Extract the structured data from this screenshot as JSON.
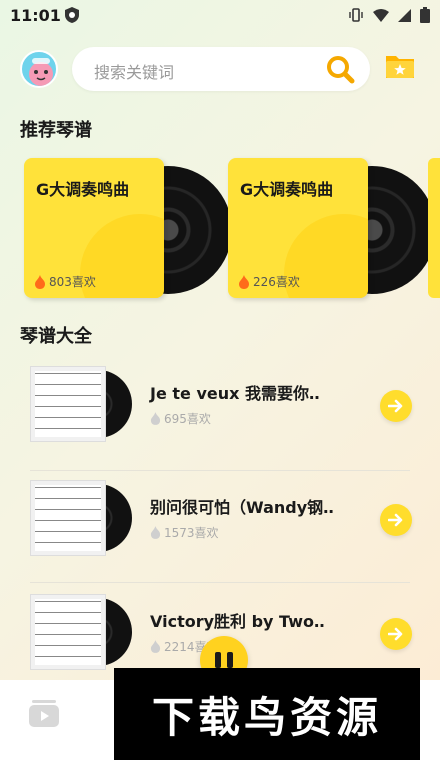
{
  "status_bar": {
    "time": "11:01"
  },
  "search": {
    "placeholder": "搜索关键词"
  },
  "recommended": {
    "title": "推荐琴谱",
    "cards": [
      {
        "title": "G大调奏鸣曲",
        "likes": "803喜欢"
      },
      {
        "title": "G大调奏鸣曲",
        "likes": "226喜欢"
      }
    ]
  },
  "library": {
    "title": "琴谱大全",
    "items": [
      {
        "title": "Je te veux 我需要你‥",
        "likes": "695喜欢"
      },
      {
        "title": "别问很可怕（Wandy钢‥",
        "likes": "1573喜欢"
      },
      {
        "title": "Victory胜利 by Two‥",
        "likes": "2214喜欢"
      }
    ]
  },
  "watermark": {
    "text": "下载鸟资源"
  },
  "colors": {
    "accent": "#ffdd2c",
    "card_bg": "#ffe23a"
  },
  "icons": [
    "shield-icon",
    "vibrate-icon",
    "wifi-icon",
    "signal-icon",
    "battery-icon",
    "search-icon",
    "folder-star-icon",
    "fire-icon",
    "arrow-right-icon",
    "pause-icon",
    "play-tab-icon"
  ]
}
